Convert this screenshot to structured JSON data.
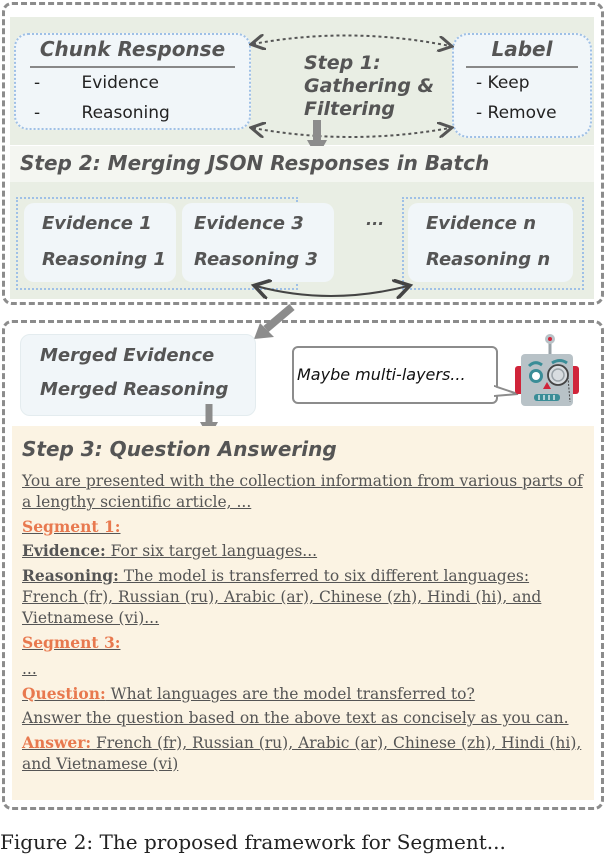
{
  "step1": {
    "chunk_title": "Chunk Response",
    "chunk_items": [
      "Evidence",
      "Reasoning"
    ],
    "title_line1": "Step 1:",
    "title_line2": "Gathering &",
    "title_line3": "Filtering",
    "label_title": "Label",
    "label_items": [
      "- Keep",
      "- Remove"
    ],
    "bullet": "-"
  },
  "step2": {
    "title": "Step 2: Merging JSON Responses in Batch",
    "cards": [
      {
        "evidence": "Evidence 1",
        "reasoning": "Reasoning 1"
      },
      {
        "evidence": "Evidence 3",
        "reasoning": "Reasoning 3"
      },
      {
        "evidence": "Evidence n",
        "reasoning": "Reasoning n"
      }
    ],
    "ellipsis": "..."
  },
  "merged": {
    "evidence": "Merged Evidence",
    "reasoning": "Merged Reasoning"
  },
  "robot": {
    "speech": "Maybe multi-layers..."
  },
  "step3": {
    "title": "Step 3: Question Answering",
    "intro": "You are presented with the collection information from various parts of a lengthy scientific article, ...",
    "segment1_label": "Segment 1:",
    "evidence_label": "Evidence:",
    "evidence_text": " For six target languages...",
    "reasoning_label": "Reasoning:",
    "reasoning_text": " The model is transferred to six different languages: French (fr), Russian (ru), Arabic (ar), Chinese (zh), Hindi (hi), and Vietnamese (vi)...",
    "segment3_label": "Segment 3:",
    "ellipsis": "...",
    "question_label": "Question:",
    "question_text": " What languages are the model transferred to?",
    "instruction": "Answer the question based on the above text as concisely as you can.",
    "answer_label": "Answer:",
    "answer_text": " French (fr), Russian (ru), Arabic (ar), Chinese (zh), Hindi (hi), and Vietnamese (vi)"
  },
  "caption": {
    "text": "Figure 2: The proposed framework for Segment..."
  },
  "colors": {
    "accent_orange": "#e8794f",
    "panel_green": "#e9eee4",
    "panel_cream": "#fbf3e3",
    "box_light": "#f1f6f9",
    "dotted_blue": "#9fc0e6",
    "text_gray": "#555555"
  }
}
